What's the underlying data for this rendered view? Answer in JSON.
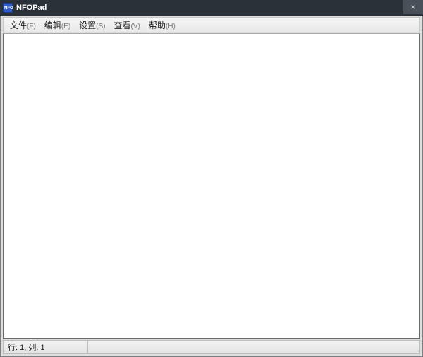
{
  "title": "NFOPad",
  "icon_name": "nfo-icon",
  "close_glyph": "×",
  "menu": [
    {
      "label": "文件",
      "shortcut": "(F)"
    },
    {
      "label": "编辑",
      "shortcut": "(E)"
    },
    {
      "label": "设置",
      "shortcut": "(S)"
    },
    {
      "label": "查看",
      "shortcut": "(V)"
    },
    {
      "label": "帮助",
      "shortcut": "(H)"
    }
  ],
  "editor": {
    "content": ""
  },
  "status": {
    "cursor": "行: 1, 列: 1"
  }
}
